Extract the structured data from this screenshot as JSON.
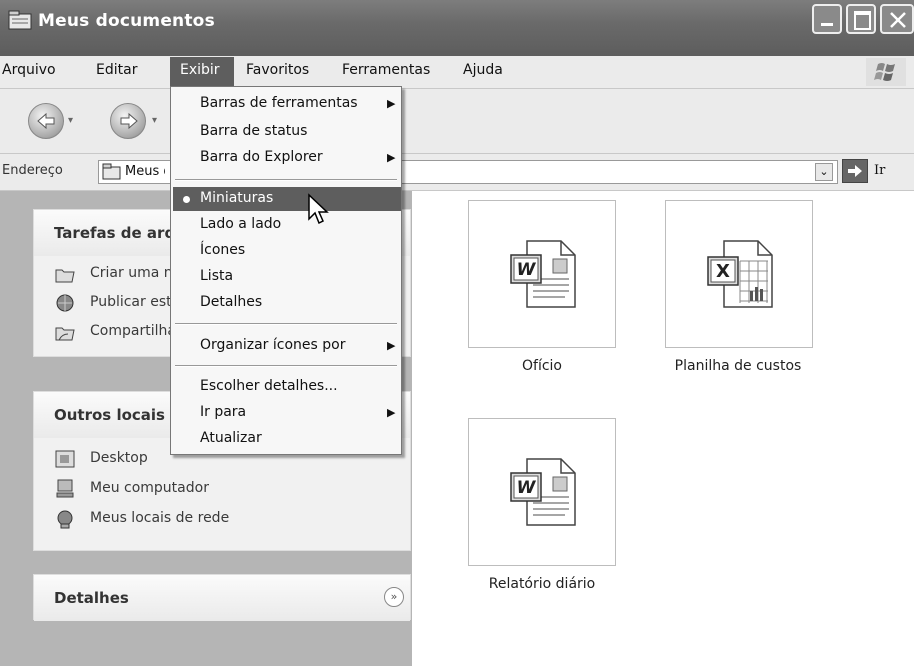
{
  "window": {
    "title": "Meus documentos"
  },
  "menubar": {
    "items": [
      "Arquivo",
      "Editar",
      "Exibir",
      "Favoritos",
      "Ferramentas",
      "Ajuda"
    ],
    "active": "Exibir"
  },
  "address": {
    "label": "Endereço",
    "value": "Meus documentos",
    "go_label": "Ir"
  },
  "left_panel": {
    "tasks": {
      "title": "Tarefas de arquivo e pasta",
      "links": [
        "Criar uma nova pasta",
        "Publicar esta pasta na Web",
        "Compartilhar esta pasta"
      ]
    },
    "other_places": {
      "title": "Outros locais",
      "links": [
        "Desktop",
        "Meu computador",
        "Meus locais de rede"
      ]
    },
    "details": {
      "title": "Detalhes"
    }
  },
  "files": [
    {
      "name": "Ofício",
      "type": "word-doc-icon"
    },
    {
      "name": "Planilha de custos",
      "type": "excel-sheet-icon"
    },
    {
      "name": "Relatório diário",
      "type": "word-doc-icon"
    }
  ],
  "view_menu": {
    "items": [
      {
        "label": "Barras de ferramentas",
        "submenu": true
      },
      {
        "label": "Barra de status",
        "submenu": false
      },
      {
        "label": "Barra do Explorer",
        "submenu": true
      },
      {
        "label": "Miniaturas",
        "selected": true,
        "highlighted": true
      },
      {
        "label": "Lado a lado"
      },
      {
        "label": "Ícones"
      },
      {
        "label": "Lista"
      },
      {
        "label": "Detalhes"
      },
      {
        "label": "Organizar ícones por",
        "submenu": true
      },
      {
        "label": "Escolher detalhes..."
      },
      {
        "label": "Ir para",
        "submenu": true
      },
      {
        "label": "Atualizar"
      }
    ]
  },
  "colors": {
    "highlight": "#5e5e5e",
    "titlebar": "#6a6a6a",
    "pane": "#b5b5b5"
  }
}
